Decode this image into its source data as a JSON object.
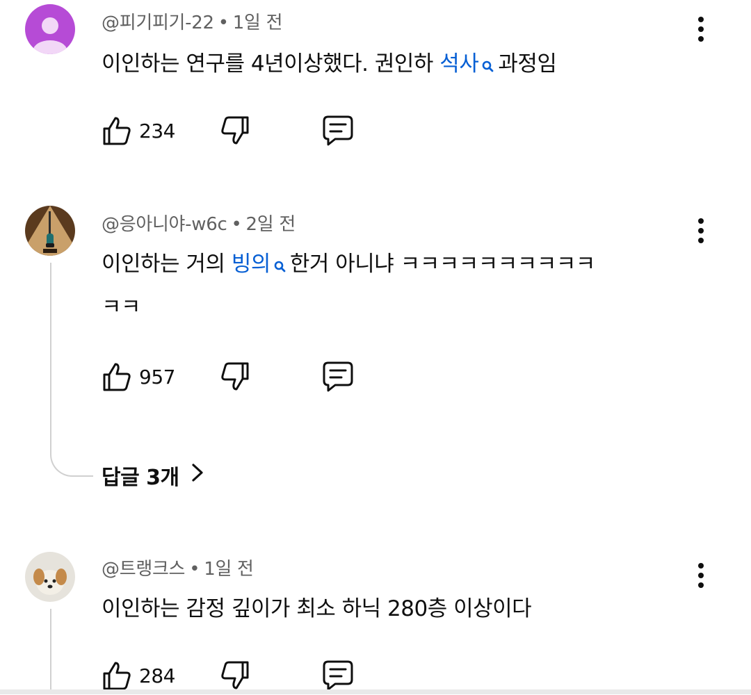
{
  "comments": [
    {
      "handle": "@피기피기-22",
      "time": "1일 전",
      "text_before": "이인하는 연구를 4년이상했다. 권인하 ",
      "link": "석사",
      "text_after": "과정임",
      "likes": "234",
      "avatar_color": "#b64bd6"
    },
    {
      "handle": "@응아니야-w6c",
      "time": "2일 전",
      "line1_before": "이인하는 거의 ",
      "link": "빙의",
      "line1_after": "한거 아니냐 ㅋㅋㅋㅋㅋㅋㅋㅋㅋㅋ",
      "line2": "ㅋㅋ",
      "likes": "957",
      "replies_label": "답글 3개"
    },
    {
      "handle": "@트랭크스",
      "time": "1일 전",
      "text": "이인하는 감정 깊이가 최소 하닉 280층 이상이다",
      "likes": "284"
    }
  ],
  "separator": "•",
  "icons": {
    "like": "thumbs-up-icon",
    "dislike": "thumbs-down-icon",
    "reply": "comment-icon",
    "more": "kebab-menu-icon",
    "search": "search-icon",
    "chevron": "chevron-right-icon"
  },
  "colors": {
    "link": "#065fd4",
    "meta": "#606060",
    "text": "#0f0f0f"
  }
}
